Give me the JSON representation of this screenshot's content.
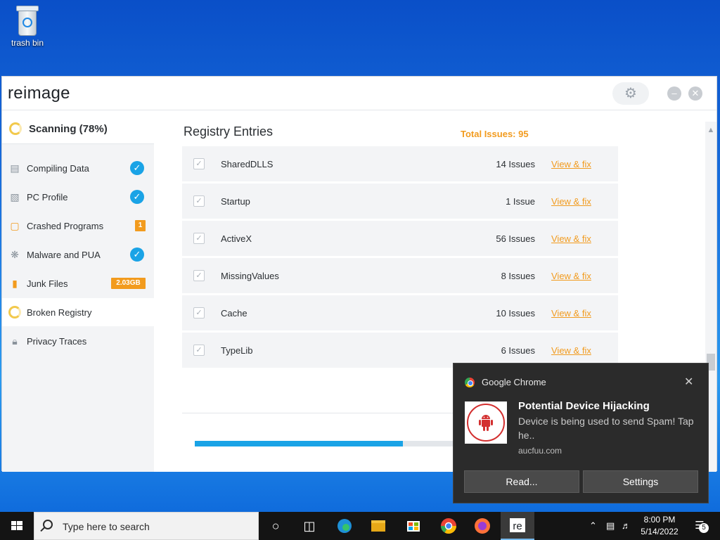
{
  "desktop": {
    "trash_label": "trash bin"
  },
  "app": {
    "logo": "reimage",
    "sidebar": {
      "scan_title": "Scanning (78%)",
      "items": [
        {
          "label": "Compiling Data",
          "status": "done"
        },
        {
          "label": "PC Profile",
          "status": "done"
        },
        {
          "label": "Crashed Programs",
          "badge": "1"
        },
        {
          "label": "Malware and PUA",
          "status": "done"
        },
        {
          "label": "Junk Files",
          "badge": "2.03GB"
        },
        {
          "label": "Broken Registry",
          "status": "scanning"
        },
        {
          "label": "Privacy Traces",
          "status": "locked"
        }
      ]
    },
    "main": {
      "title": "Registry Entries",
      "total_issues": "Total Issues: 95",
      "rows": [
        {
          "name": "SharedDLLS",
          "count": "14 Issues",
          "action": "View & fix"
        },
        {
          "name": "Startup",
          "count": "1 Issue",
          "action": "View & fix"
        },
        {
          "name": "ActiveX",
          "count": "56 Issues",
          "action": "View & fix"
        },
        {
          "name": "MissingValues",
          "count": "8 Issues",
          "action": "View & fix"
        },
        {
          "name": "Cache",
          "count": "10 Issues",
          "action": "View & fix"
        },
        {
          "name": "TypeLib",
          "count": "6 Issues",
          "action": "View & fix"
        }
      ],
      "progress_fraction": 0.78
    }
  },
  "notification": {
    "source": "Google Chrome",
    "title": "Potential Device Hijacking",
    "body": "Device is being used to send Spam! Tap he..",
    "site": "aucfuu.com",
    "buttons": {
      "primary": "Read...",
      "secondary": "Settings"
    }
  },
  "taskbar": {
    "search_placeholder": "Type here to search",
    "time": "8:00 PM",
    "date": "5/14/2022",
    "notification_count": "5"
  },
  "colors": {
    "accent": "#1aa3e6",
    "warning": "#f29b1e",
    "taskbar": "#141414"
  }
}
